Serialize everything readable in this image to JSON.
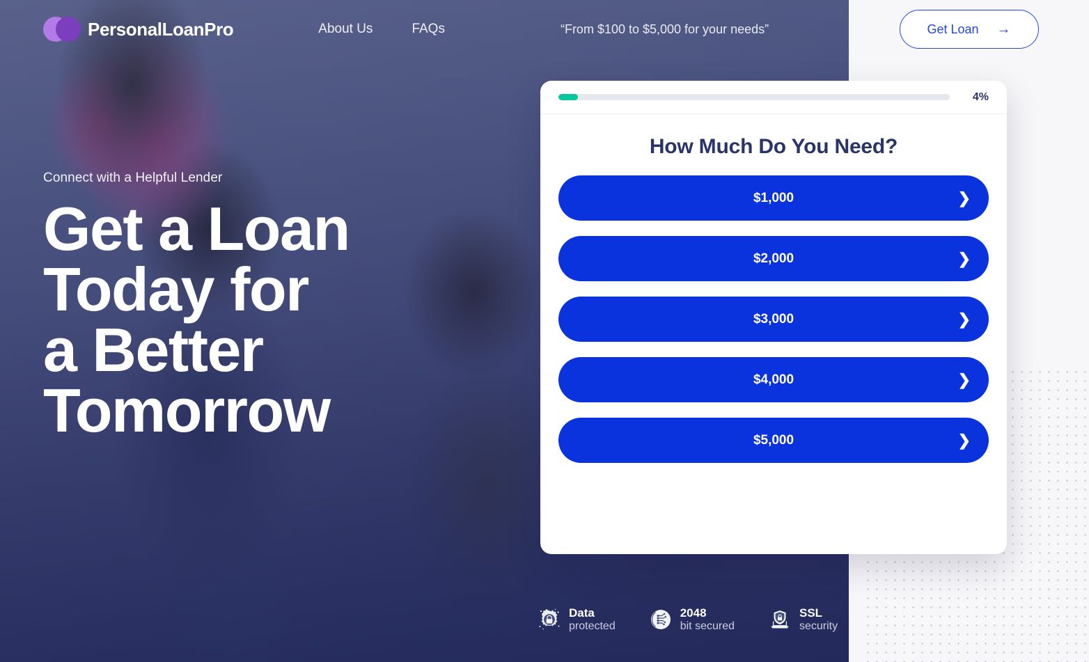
{
  "header": {
    "brand_name": "PersonalLoanPro",
    "logo_icon": "two-overlapping-circles-icon",
    "logo_color_light": "#b47ae8",
    "logo_color_dark": "#7b3fbd",
    "nav": [
      {
        "label": "About Us",
        "name": "nav-about-us"
      },
      {
        "label": "FAQs",
        "name": "nav-faqs"
      }
    ],
    "tagline": "“From $100 to $5,000 for your needs”",
    "cta": {
      "label": "Get Loan",
      "icon": "arrow-right-icon",
      "glyph": "→",
      "color": "#1f47e0"
    }
  },
  "hero": {
    "eyebrow": "Connect with a Helpful Lender",
    "headline_lines": [
      "Get a Loan",
      "Today for",
      "a Better",
      "Tomorrow"
    ]
  },
  "card": {
    "progress": {
      "percent_label": "4%",
      "percent_value": 4,
      "fill_color": "#04c89c",
      "track_color": "#e6e8ee"
    },
    "title": "How Much Do You Need?",
    "button_color": "#0b33dd",
    "chevron_icon": "chevron-right-icon",
    "chevron_glyph": "❯",
    "options": [
      {
        "label": "$1,000",
        "name": "loan-amount-1000"
      },
      {
        "label": "$2,000",
        "name": "loan-amount-2000"
      },
      {
        "label": "$3,000",
        "name": "loan-amount-3000"
      },
      {
        "label": "$4,000",
        "name": "loan-amount-4000"
      },
      {
        "label": "$5,000",
        "name": "loan-amount-5000"
      }
    ]
  },
  "badges": [
    {
      "icon": "gear-lock-icon",
      "line1": "Data",
      "line2": "protected",
      "name": "badge-data-protected"
    },
    {
      "icon": "circuit-circle-icon",
      "line1": "2048",
      "line2": "bit secured",
      "name": "badge-2048-bit-secured"
    },
    {
      "icon": "laptop-shield-lock-icon",
      "line1": "SSL",
      "line2": "security",
      "name": "badge-ssl-security"
    }
  ]
}
